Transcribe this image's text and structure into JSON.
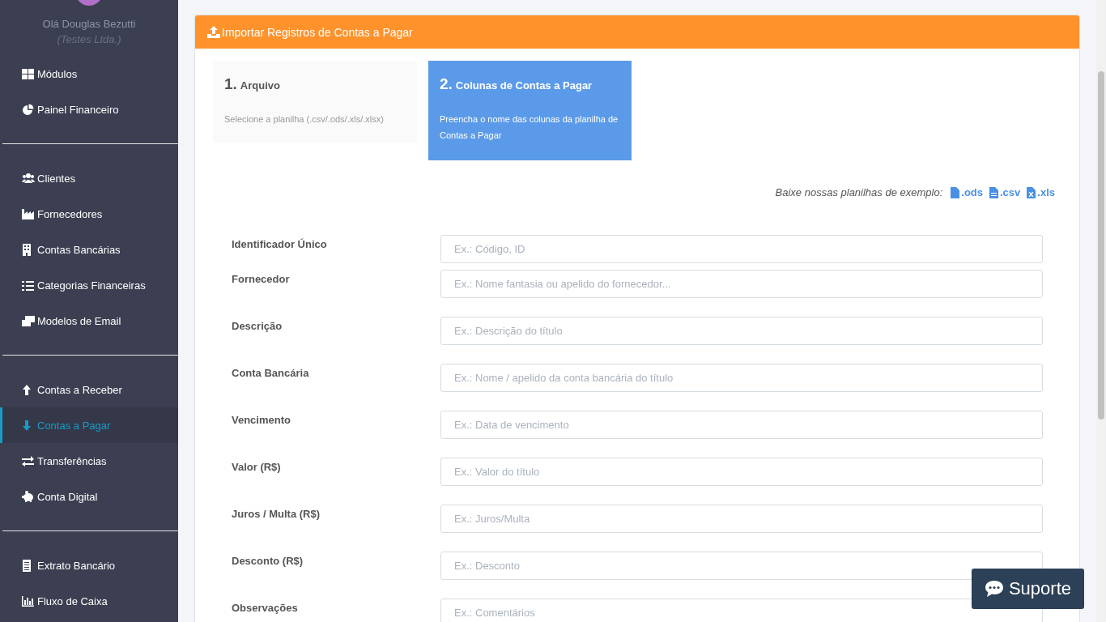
{
  "sidebar": {
    "greeting": "Olá Douglas Bezutti",
    "company": "(Testes Ltda.)",
    "groups": [
      {
        "items": [
          {
            "label": "Módulos",
            "selected": false
          },
          {
            "label": "Painel Financeiro",
            "selected": false
          }
        ]
      },
      {
        "items": [
          {
            "label": "Clientes",
            "selected": false
          },
          {
            "label": "Fornecedores",
            "selected": false
          },
          {
            "label": "Contas Bancárias",
            "selected": false
          },
          {
            "label": "Categorias Financeiras",
            "selected": false
          },
          {
            "label": "Modelos de Email",
            "selected": false
          }
        ]
      },
      {
        "items": [
          {
            "label": "Contas a Receber",
            "selected": false
          },
          {
            "label": "Contas a Pagar",
            "selected": true
          },
          {
            "label": "Transferências",
            "selected": false
          },
          {
            "label": "Conta Digital",
            "selected": false
          }
        ]
      },
      {
        "items": [
          {
            "label": "Extrato Bancário",
            "selected": false
          },
          {
            "label": "Fluxo de Caixa",
            "selected": false
          }
        ]
      }
    ]
  },
  "panel": {
    "title": "Importar Registros de Contas a Pagar",
    "steps": [
      {
        "number": "1.",
        "title": "Arquivo",
        "description": "Selecione a planilha (.csv/.ods/.xls/.xlsx)",
        "selected": false
      },
      {
        "number": "2.",
        "title": "Colunas de Contas a Pagar",
        "description": "Preencha o nome das colunas da planilha de Contas a Pagar",
        "selected": true
      }
    ],
    "examples": {
      "label": "Baixe nossas planilhas de exemplo:",
      "links": [
        {
          "label": ".ods",
          "kind": "file"
        },
        {
          "label": ".csv",
          "kind": "text"
        },
        {
          "label": ".xls",
          "kind": "excel"
        }
      ]
    },
    "fields": [
      {
        "label": "Identificador Único",
        "placeholder": "Ex.: Código, ID"
      },
      {
        "label": "Fornecedor",
        "placeholder": "Ex.: Nome fantasia ou apelido do fornecedor..."
      },
      {
        "label": "Descrição",
        "placeholder": "Ex.: Descrição do título"
      },
      {
        "label": "Conta Bancária",
        "placeholder": "Ex.: Nome / apelido da conta bancária do título"
      },
      {
        "label": "Vencimento",
        "placeholder": "Ex.: Data de vencimento"
      },
      {
        "label": "Valor (R$)",
        "placeholder": "Ex.: Valor do título"
      },
      {
        "label": "Juros / Multa (R$)",
        "placeholder": "Ex.: Juros/Multa"
      },
      {
        "label": "Desconto (R$)",
        "placeholder": "Ex.: Desconto"
      },
      {
        "label": "Observações",
        "placeholder": "Ex.: Comentários"
      }
    ]
  },
  "support_button": {
    "label": "Suporte"
  }
}
